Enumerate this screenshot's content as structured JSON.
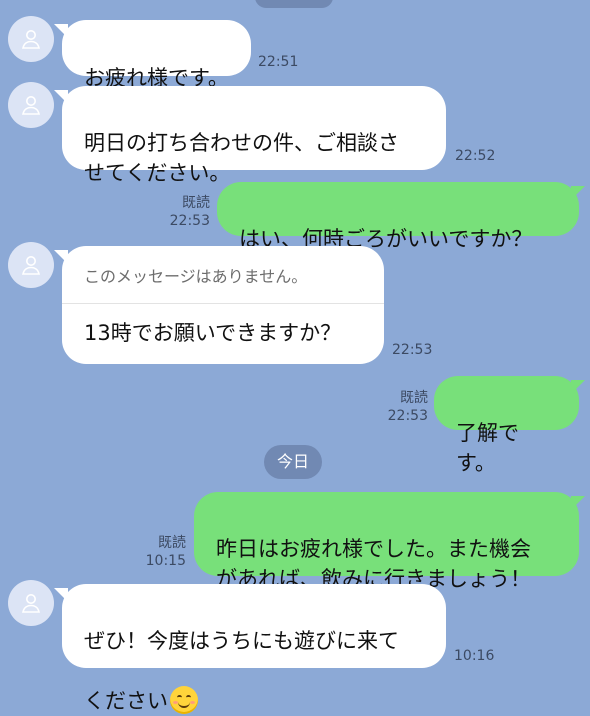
{
  "messages": [
    {
      "text": "お疲れ様です。",
      "time": "22:51"
    },
    {
      "text": "明日の打ち合わせの件、ご相談さ\nせてください。",
      "time": "22:52"
    },
    {
      "text": "はい、何時ごろがいいですか？",
      "read": "既読",
      "time": "22:53"
    },
    {
      "quoted": "このメッセージはありません。",
      "text": "13時でお願いできますか？",
      "time": "22:53"
    },
    {
      "text": "了解です。",
      "read": "既読",
      "time": "22:53"
    },
    {
      "text": "昨日はお疲れ様でした。また機会\nがあれば、飲みに行きましょう！",
      "read": "既読",
      "time": "10:15"
    },
    {
      "text_line1": "ぜひ！今度はうちにも遊びに来て",
      "text_line2": "ください",
      "emoji": "smiling-face-icon",
      "time": "10:16"
    }
  ],
  "date_separator": "今日",
  "colors": {
    "background": "#8ca9d6",
    "incoming_bubble": "#ffffff",
    "outgoing_bubble": "#78e07a",
    "date_pill": "#7189b3"
  }
}
